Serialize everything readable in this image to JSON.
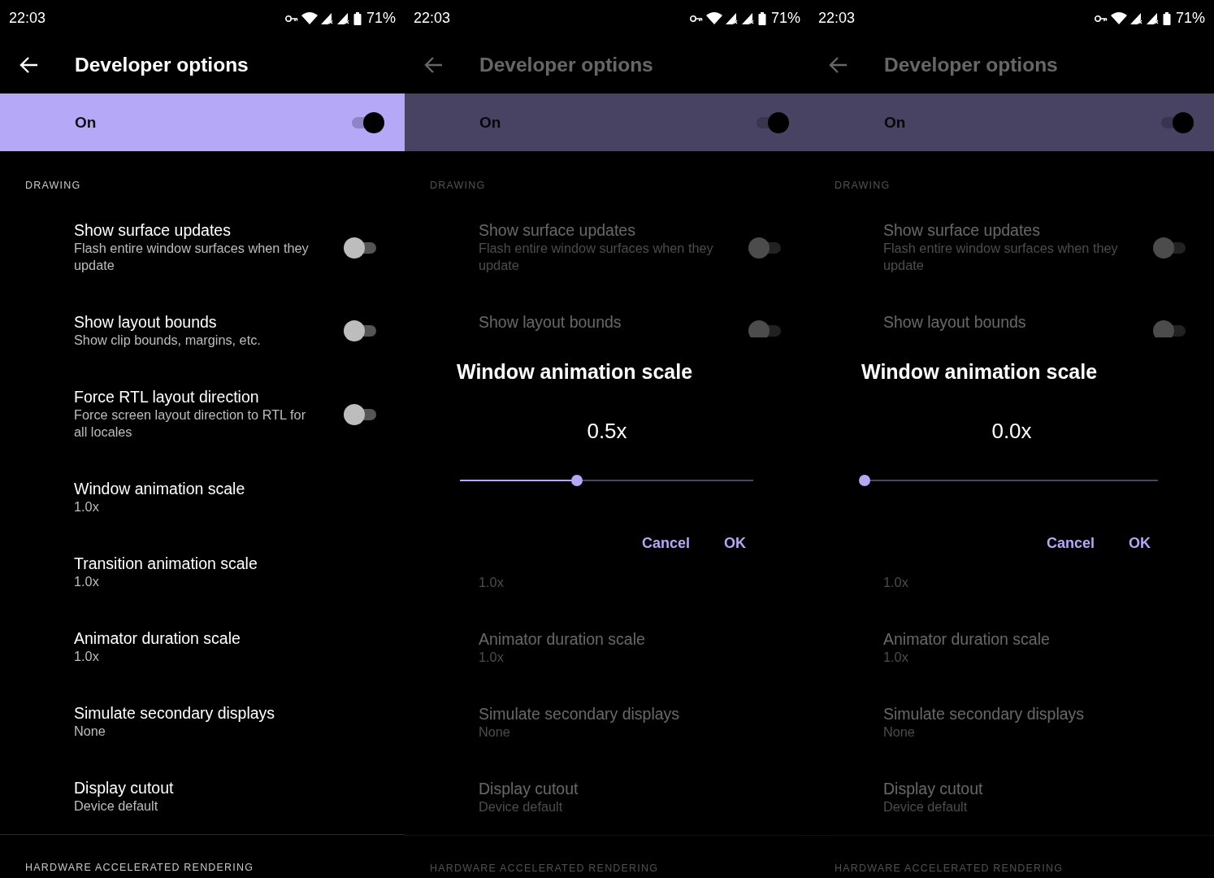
{
  "screens": [
    {
      "status_bar": {
        "time": "22:03",
        "battery": "71%"
      },
      "title": "Developer options",
      "dimmed": false,
      "master": {
        "label": "On",
        "on": true
      },
      "blocks": [
        {
          "kind": "header",
          "text": "DRAWING"
        },
        {
          "kind": "switch",
          "title": "Show surface updates",
          "summary": "Flash entire window surfaces when they update",
          "on": false
        },
        {
          "kind": "switch",
          "title": "Show layout bounds",
          "summary": "Show clip bounds, margins, etc.",
          "on": false
        },
        {
          "kind": "switch",
          "title": "Force RTL layout direction",
          "summary": "Force screen layout direction to RTL for all locales",
          "on": false
        },
        {
          "kind": "value",
          "title": "Window animation scale",
          "summary": "1.0x"
        },
        {
          "kind": "value",
          "title": "Transition animation scale",
          "summary": "1.0x"
        },
        {
          "kind": "value",
          "title": "Animator duration scale",
          "summary": "1.0x"
        },
        {
          "kind": "value",
          "title": "Simulate secondary displays",
          "summary": "None"
        },
        {
          "kind": "value",
          "title": "Display cutout",
          "summary": "Device default"
        },
        {
          "kind": "header",
          "text": "HARDWARE ACCELERATED RENDERING"
        }
      ]
    },
    {
      "status_bar": {
        "time": "22:03",
        "battery": "71%"
      },
      "title": "Developer options",
      "dimmed": true,
      "master": {
        "label": "On",
        "on": true
      },
      "blocks": [
        {
          "kind": "header",
          "text": "DRAWING"
        },
        {
          "kind": "switch",
          "title": "Show surface updates",
          "summary": "Flash entire window surfaces when they update",
          "on": false
        },
        {
          "kind": "switch",
          "title": "Show layout bounds",
          "on": false
        },
        {
          "kind": "dialog",
          "title": "Window animation scale",
          "value": "0.5x",
          "level": 0.4,
          "buttons": [
            "Cancel",
            "OK"
          ]
        },
        {
          "kind": "value",
          "summary": "1.0x"
        },
        {
          "kind": "value",
          "title": "Animator duration scale",
          "summary": "1.0x"
        },
        {
          "kind": "value",
          "title": "Simulate secondary displays",
          "summary": "None"
        },
        {
          "kind": "value",
          "title": "Display cutout",
          "summary": "Device default"
        },
        {
          "kind": "header",
          "text": "HARDWARE ACCELERATED RENDERING"
        }
      ]
    },
    {
      "status_bar": {
        "time": "22:03",
        "battery": "71%"
      },
      "title": "Developer options",
      "dimmed": true,
      "master": {
        "label": "On",
        "on": true
      },
      "blocks": [
        {
          "kind": "header",
          "text": "DRAWING"
        },
        {
          "kind": "switch",
          "title": "Show surface updates",
          "summary": "Flash entire window surfaces when they update",
          "on": false
        },
        {
          "kind": "switch",
          "title": "Show layout bounds",
          "on": false
        },
        {
          "kind": "dialog",
          "title": "Window animation scale",
          "value": "0.0x",
          "level": 0,
          "buttons": [
            "Cancel",
            "OK"
          ]
        },
        {
          "kind": "value",
          "summary": "1.0x"
        },
        {
          "kind": "value",
          "title": "Animator duration scale",
          "summary": "1.0x"
        },
        {
          "kind": "value",
          "title": "Simulate secondary displays",
          "summary": "None"
        },
        {
          "kind": "value",
          "title": "Display cutout",
          "summary": "Device default"
        },
        {
          "kind": "header",
          "text": "HARDWARE ACCELERATED RENDERING"
        }
      ]
    }
  ]
}
